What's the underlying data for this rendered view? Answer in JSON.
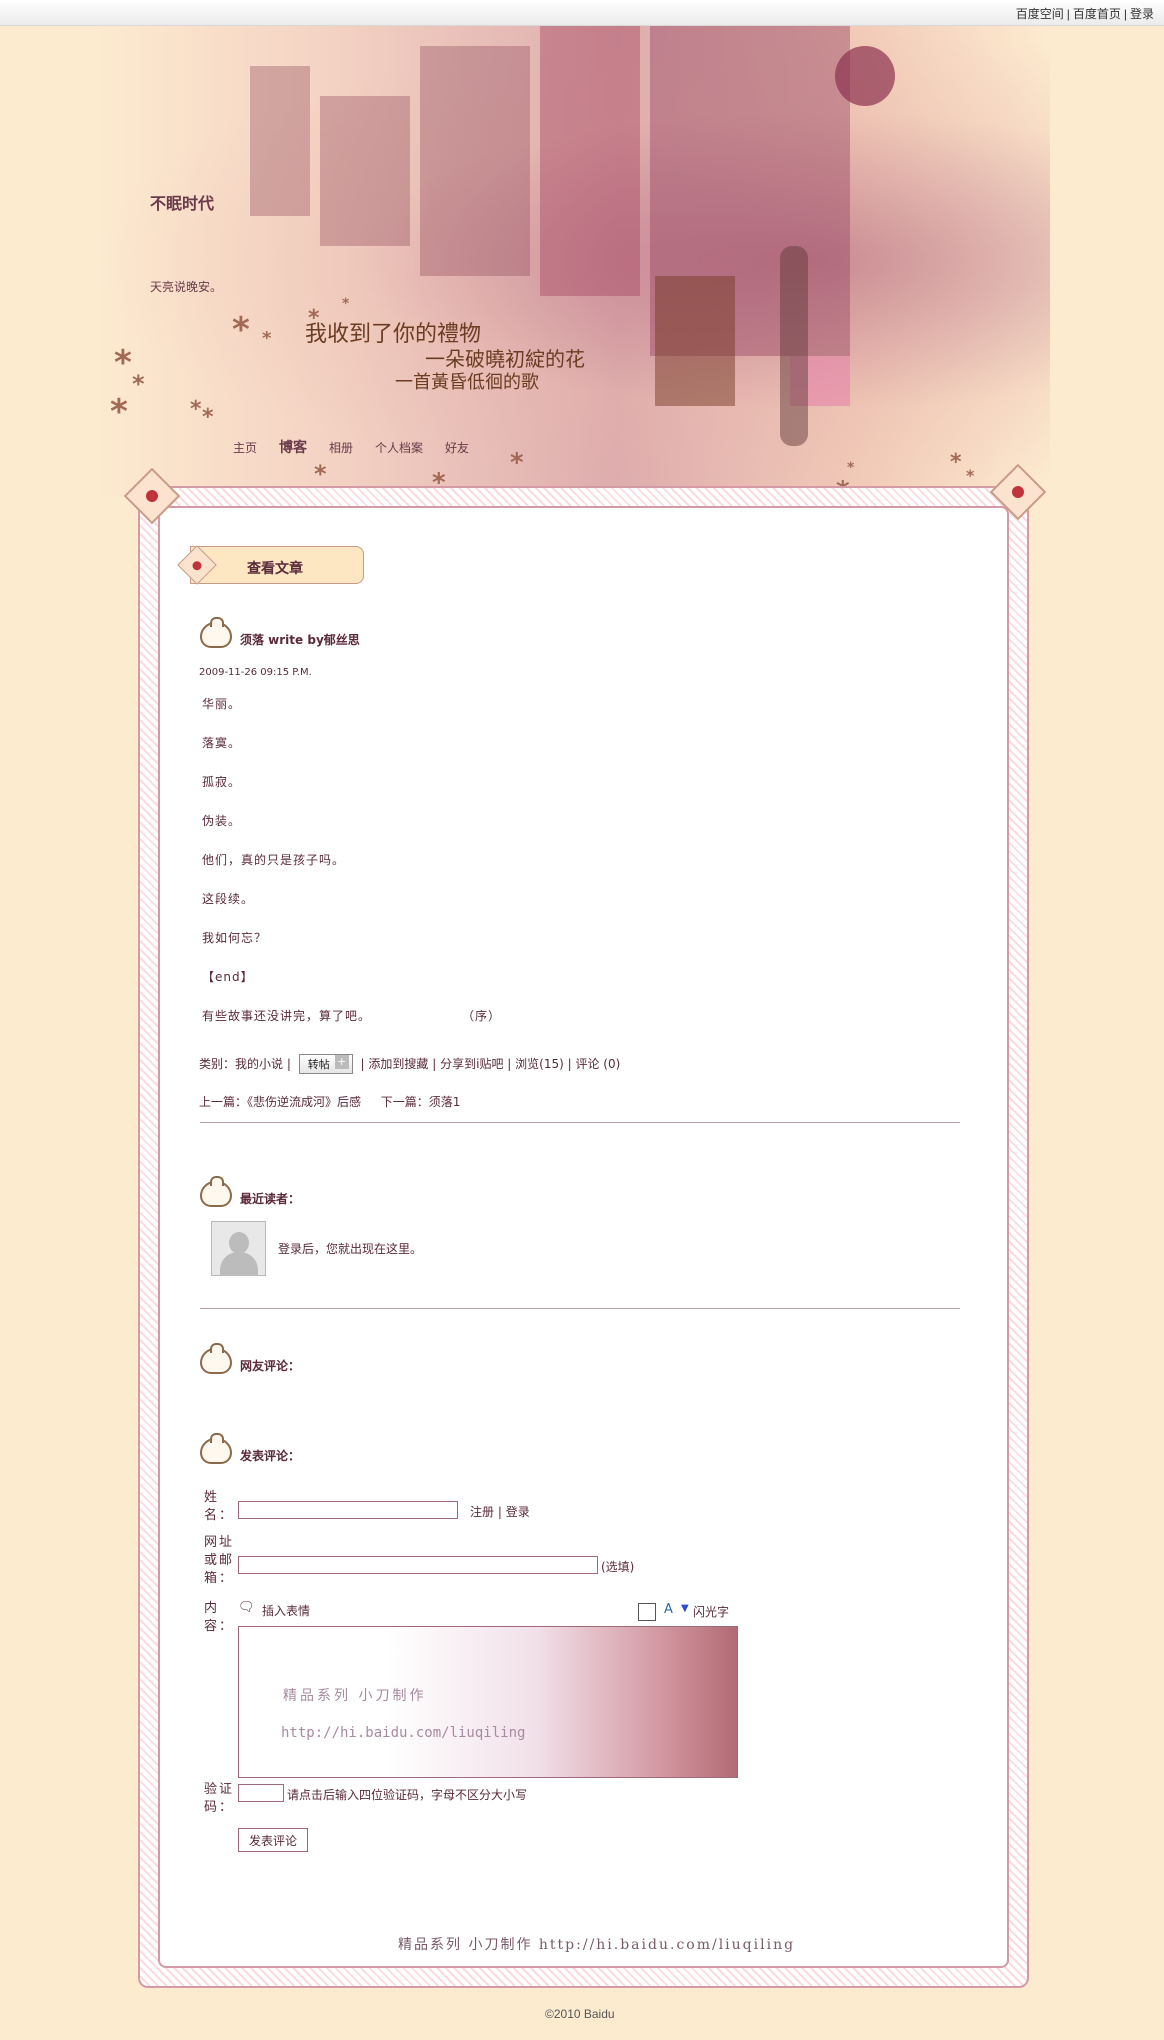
{
  "topbar": {
    "links": [
      "百度空间",
      "百度首页",
      "登录"
    ]
  },
  "header": {
    "title": "不眠时代",
    "subtitle": "天亮说晚安。",
    "poem": {
      "line1": "我收到了你的禮物",
      "line2": "一朵破曉初綻的花",
      "line3": "一首黃昏低徊的歌"
    },
    "nav": [
      "主页",
      "博客",
      "相册",
      "个人档案",
      "好友"
    ],
    "nav_active": "博客"
  },
  "section_title": "查看文章",
  "article": {
    "title": "须落  write by郁丝思",
    "date": "2009-11-26 09:15 P.M.",
    "paragraphs": [
      "华丽。",
      "落寞。",
      "孤寂。",
      "伪装。",
      "他们，真的只是孩子吗。",
      "这段续。",
      "我如何忘？",
      "【end】"
    ],
    "last_line": "有些故事还没讲完，算了吧。",
    "last_line_tag": "（序）",
    "meta": {
      "category_label": "类别：",
      "category": "我的小说",
      "share_button": "转帖",
      "add_search": "添加到搜藏",
      "share_tieba": "分享到i贴吧",
      "views": "浏览(15)",
      "comments": "评论 (0)"
    },
    "prev_label": "上一篇：",
    "prev": "《悲伤逆流成河》后感",
    "next_label": "下一篇：",
    "next": "须落1"
  },
  "readers": {
    "heading": "最近读者：",
    "login_hint": "登录后，您就出现在这里。"
  },
  "comments": {
    "heading": "网友评论："
  },
  "post_comment": {
    "heading": "发表评论：",
    "name_label": "姓名：",
    "register": "注册",
    "login": "登录",
    "url_label": "网址或邮箱：",
    "optional": "(选填)",
    "content_label": "内容：",
    "insert_emoji": "插入表情",
    "flash_text": "闪光字",
    "watermark1": "精品系列  小刀制作",
    "watermark2": "http://hi.baidu.com/liuqiling",
    "captcha_label": "验证码：",
    "captcha_hint": "请点击后输入四位验证码，字母不区分大小写",
    "submit": "发表评论"
  },
  "footer": {
    "sign": "精品系列  小刀制作  http://hi.baidu.com/liuqiling",
    "copyright": "©2010 Baidu"
  }
}
